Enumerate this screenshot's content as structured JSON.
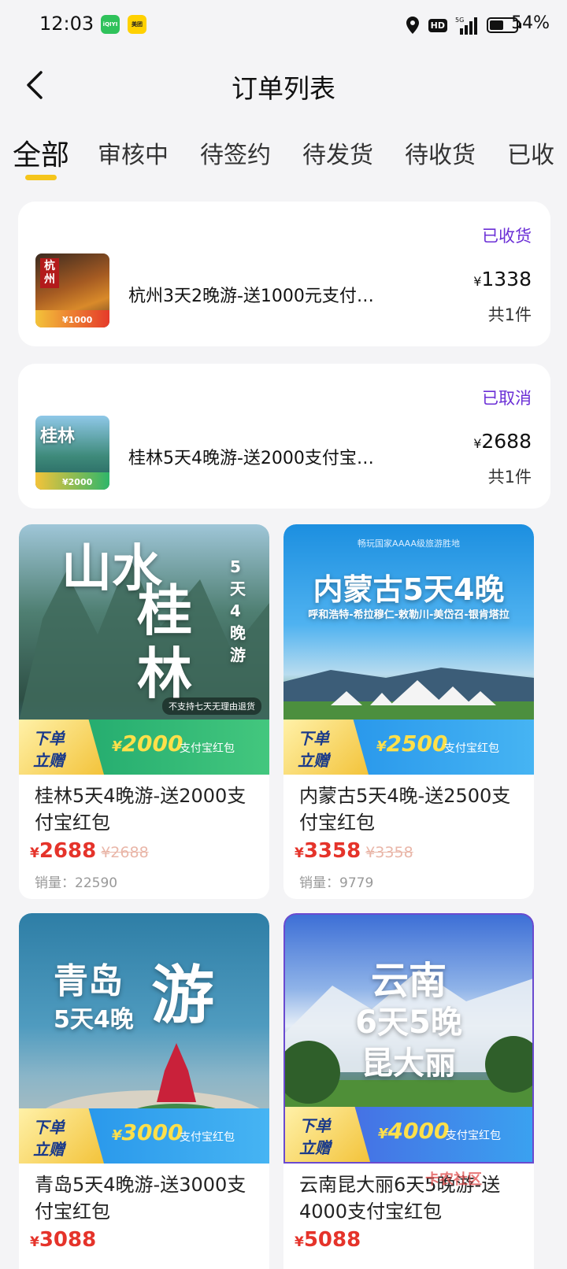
{
  "status_bar": {
    "time": "12:03",
    "app_icon_1": "iQIYI",
    "app_icon_2": "美团",
    "battery": "54%",
    "battery_level": 0.54,
    "network": "5G",
    "hd": "HD"
  },
  "nav": {
    "title": "订单列表",
    "back_icon": "chevron-left-icon"
  },
  "tabs": [
    "全部",
    "审核中",
    "待签约",
    "待发货",
    "待收货",
    "已收"
  ],
  "active_tab": 0,
  "accent_color": "#f5c51b",
  "status_color": "#6b2fd6",
  "orders": [
    {
      "status": "已收货",
      "title": "杭州3天2晚游-送1000元支付宝...",
      "price": "1338",
      "qty": "共1件",
      "thumb": {
        "place": "杭州",
        "bonus": "¥1000"
      }
    },
    {
      "status": "已取消",
      "title": "桂林5天4晚游-送2000支付宝红包",
      "price": "2688",
      "qty": "共1件",
      "thumb": {
        "place": "桂林",
        "bonus": "¥2000"
      }
    }
  ],
  "currency": "¥",
  "promo_label_1": "下单",
  "promo_label_2": "立赠",
  "promo_suffix": "支付宝红包",
  "sales_label": "销量：",
  "products": [
    {
      "title": "桂林5天4晚游-送2000支付宝红包",
      "price": "2688",
      "orig": "¥2688",
      "sales": "22590",
      "bonus": "2000",
      "img_line1": "山水",
      "img_line2": "桂林",
      "img_side": "5天4晚游",
      "img_note": "不支持七天无理由退货"
    },
    {
      "title": "内蒙古5天4晚-送2500支付宝红包",
      "price": "3358",
      "orig": "¥3358",
      "sales": "9779",
      "bonus": "2500",
      "img_line1": "内蒙古5天4晚",
      "img_line2": "呼和浩特-希拉穆仁-敕勒川-美岱召-银肯塔拉",
      "img_top": "畅玩国家AAAA级旅游胜地"
    },
    {
      "title": "青岛5天4晚游-送3000支付宝红包",
      "price": "3088",
      "orig": "",
      "bonus": "3000",
      "img_line1": "青岛",
      "img_line2": "5天4晚",
      "img_side": "游"
    },
    {
      "title": "云南昆大丽6天5晚游-送4000支付宝红包",
      "price": "5088",
      "orig": "",
      "bonus": "4000",
      "img_line1": "云南",
      "img_line2": "6天5晚",
      "img_side": "昆大丽"
    }
  ],
  "watermark": "卡农社区"
}
